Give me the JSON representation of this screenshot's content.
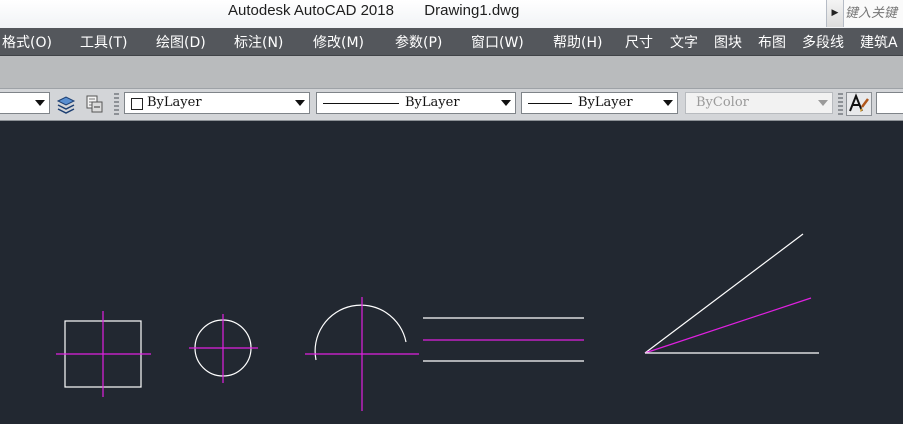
{
  "window": {
    "app_title": "Autodesk AutoCAD 2018",
    "doc_title": "Drawing1.dwg",
    "search_placeholder": "键入关键"
  },
  "menu": [
    {
      "label": "格式(O)"
    },
    {
      "label": "工具(T)"
    },
    {
      "label": "绘图(D)"
    },
    {
      "label": "标注(N)"
    },
    {
      "label": "修改(M)"
    },
    {
      "label": "参数(P)"
    },
    {
      "label": "窗口(W)"
    },
    {
      "label": "帮助(H)"
    },
    {
      "label": "尺寸"
    },
    {
      "label": "文字"
    },
    {
      "label": "图块"
    },
    {
      "label": "布图"
    },
    {
      "label": "多段线"
    },
    {
      "label": "建筑A"
    }
  ],
  "properties": {
    "color": "ByLayer",
    "linetype": "ByLayer",
    "lineweight": "ByLayer",
    "plot_style": "ByColor"
  },
  "colors": {
    "canvas_background": "#222831",
    "geometry": "#ffffff",
    "centerline": "#e020e0"
  },
  "icons": {
    "layer_previous": "layer-stack-icon",
    "layer_match": "layer-match-icon",
    "text_style": "font-style-icon"
  }
}
